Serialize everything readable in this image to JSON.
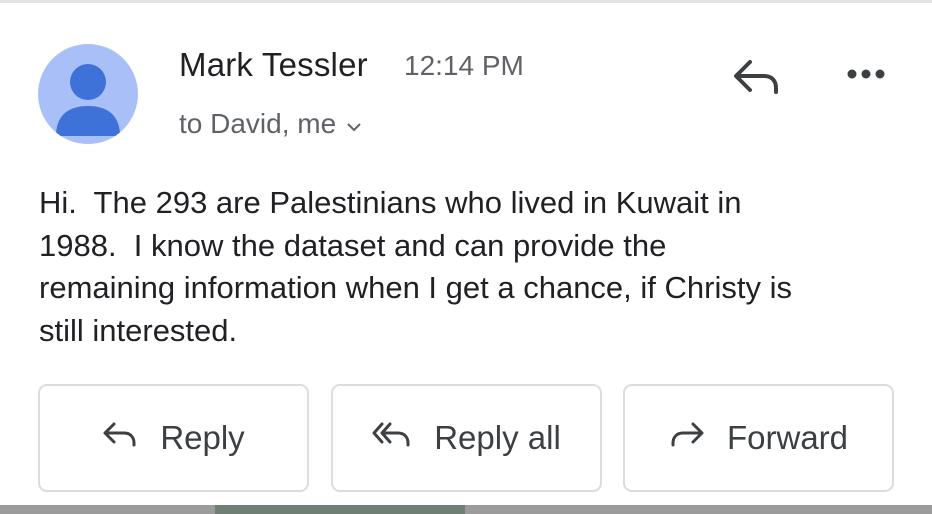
{
  "message": {
    "sender_name": "Mark Tessler",
    "time": "12:14 PM",
    "recipients": "to David, me",
    "body_lines": [
      "Hi.  The 293 are Palestinians who lived in Kuwait in",
      "1988.  I know the dataset and can provide the",
      "remaining information when I get a chance, if Christy is",
      "still interested."
    ]
  },
  "header_actions": {
    "reply_icon": "reply-icon",
    "more_icon": "more-options-icon"
  },
  "actions": {
    "reply_label": "Reply",
    "reply_all_label": "Reply all",
    "forward_label": "Forward"
  },
  "colors": {
    "avatar_bg": "#a8c0f7",
    "avatar_fg": "#3f72d9",
    "text_primary": "#202124",
    "text_secondary": "#5f6368",
    "button_border": "#dadce0"
  }
}
